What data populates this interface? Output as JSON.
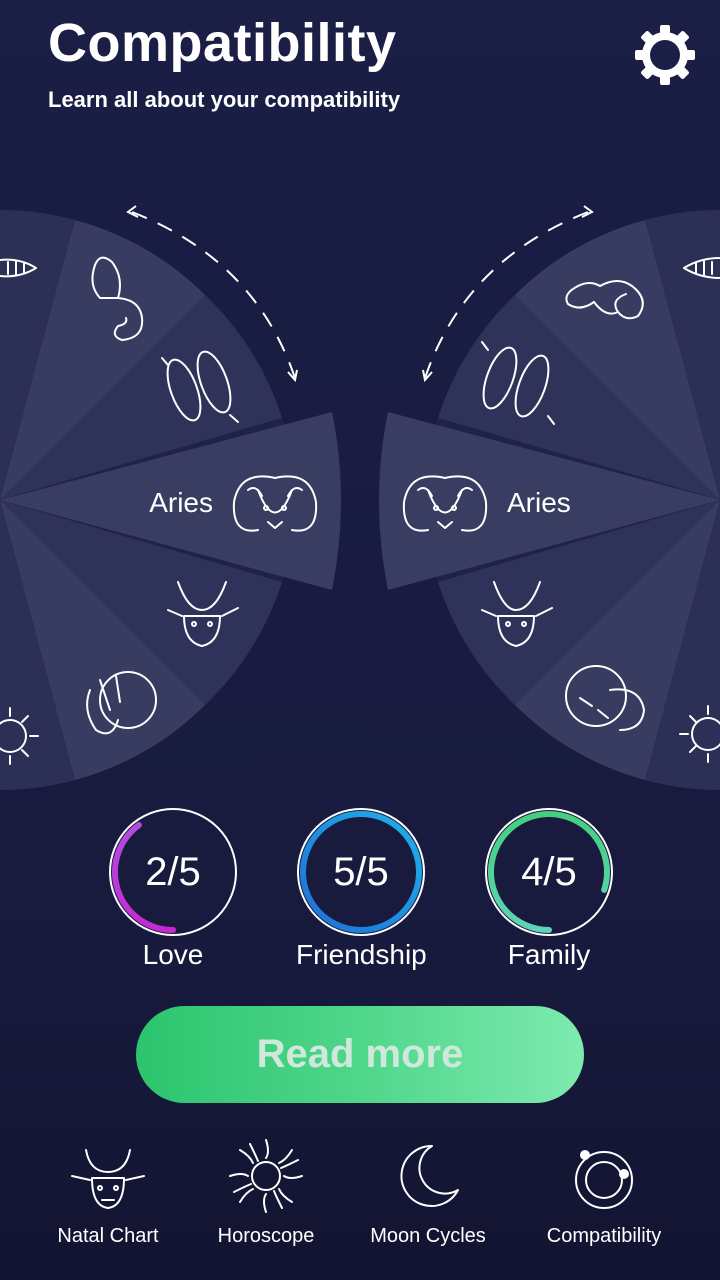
{
  "header": {
    "title": "Compatibility",
    "subtitle": "Learn all about your compatibility"
  },
  "icons": {
    "settings": "gear-icon"
  },
  "wheels": {
    "left_sign": "Aries",
    "right_sign": "Aries",
    "left_signs_visible": [
      "Capricorn",
      "Aquarius",
      "Pisces",
      "Aries",
      "Taurus",
      "Gemini",
      "Leo"
    ],
    "right_signs_visible": [
      "Capricorn",
      "Aquarius",
      "Pisces",
      "Aries",
      "Taurus",
      "Gemini",
      "Leo"
    ]
  },
  "scores": [
    {
      "label": "Love",
      "value_text": "2/5",
      "fraction": 0.4,
      "color_start": "#b24be0",
      "color_end": "#c42ad2"
    },
    {
      "label": "Friendship",
      "value_text": "5/5",
      "fraction": 1.0,
      "color_start": "#1fb0e8",
      "color_end": "#1e6fd8"
    },
    {
      "label": "Family",
      "value_text": "4/5",
      "fraction": 0.8,
      "color_start": "#43cf7d",
      "color_end": "#5fd3b8"
    }
  ],
  "cta": {
    "label": "Read more"
  },
  "nav": [
    {
      "label": "Natal Chart",
      "icon": "bull-icon"
    },
    {
      "label": "Horoscope",
      "icon": "sun-icon"
    },
    {
      "label": "Moon Cycles",
      "icon": "moon-icon"
    },
    {
      "label": "Compatibility",
      "icon": "compatibility-icon"
    }
  ],
  "colors": {
    "background": "#1b1e45",
    "wedge_light": "#3a3d62",
    "wedge_dark": "#2b2e55",
    "cta": "#2cc46e"
  }
}
